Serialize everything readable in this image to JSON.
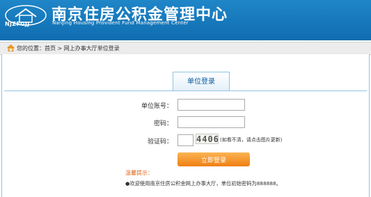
{
  "header": {
    "logo_abbr": "NJZFGJJ",
    "title_cn": "南京住房公积金管理中心",
    "title_en": "NanJing Housing Provident Fund Management Center"
  },
  "breadcrumb": {
    "icon": "home-icon",
    "text": "您的位置：首页 > 网上办事大厅单位登录"
  },
  "login": {
    "tab_label": "单位登录",
    "account_label": "单位账号：",
    "account_value": "",
    "password_label": "密码：",
    "password_value": "",
    "captcha_label": "验证码：",
    "captcha_value": "",
    "captcha_image_text": "4406",
    "captcha_hint": "(如看不清，请点击图片更新)",
    "submit_label": "立即登录"
  },
  "tips": {
    "title": "温馨提示：",
    "text": "●欢迎使用南京住房公积金网上办事大厅，单位初始密码为888888。"
  },
  "colors": {
    "header_blue": "#1a7fc2",
    "accent_orange": "#f08a1c",
    "tab_text": "#0b5aa0",
    "tips_title": "#e0651a"
  }
}
